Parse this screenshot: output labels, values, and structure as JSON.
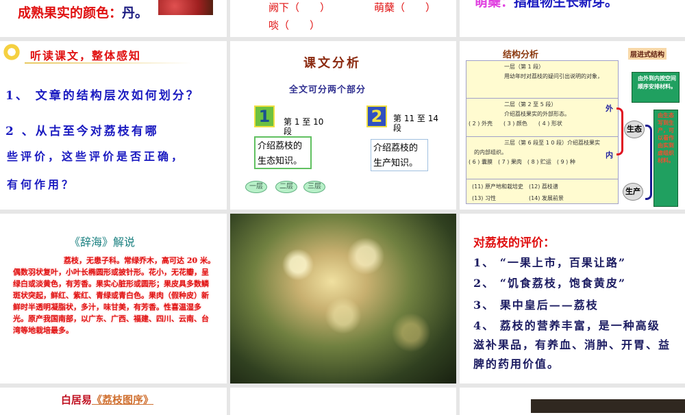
{
  "slides": [
    {
      "fruit_color_label": "成熟果实的颜色：",
      "fruit_color_value": "丹。"
    },
    {
      "item1": "阙下（　　）",
      "item2": "萌蘖（　　）",
      "item3": "啖（　　）"
    },
    {
      "term": "萌蘖：",
      "definition": "指植物生长新芽。"
    },
    {
      "title": "听读课文，整体感知",
      "q1": "1、 文章的结构层次如何划分？",
      "q2a": "2 、从古至今对荔枝有哪",
      "q2b": "些评价，这些评价是否正确，",
      "q2c": "有何作用？"
    },
    {
      "title": "课文分析",
      "subtitle": "全文可分两个部分",
      "part1_num": "1",
      "part1_range": "第 1 至 10 段",
      "part1_desc": "介绍荔枝的生态知识。",
      "part2_num": "2",
      "part2_range": "第 11 至 14 段",
      "part2_desc": "介绍荔枝的生产知识。",
      "layers": [
        "一层",
        "二层",
        "三层"
      ]
    },
    {
      "title": "结构分析",
      "tag": "层进式结构",
      "l1_head": "一层（第 1 段）",
      "l1_body": "用幼年时对荔枝的疑问引出说明的对象，",
      "l2_head": "二层（第 2 至 5 段）",
      "l2_body": "介绍荔枝果实的外部形态。",
      "l2_items": "( 2 ) 外壳　　( 3 ) 颜色　　( 4 ) 形状",
      "l3_head": "三层（第 6 段至 1 0 段）介绍荔枝果实",
      "l3_body": "的内部组织。",
      "l3_items": "( 6 ) 囊膜　( 7 ) 果肉　( 8 ) 贮运　( 9 ) 种",
      "p2_a": "(11) 原产地和栽培史",
      "p2_b": "(12) 荔枝谱",
      "p2_c": "(13) 习性",
      "p2_d": "(14) 发展前景",
      "outer": "外",
      "inner": "内",
      "eco": "生态",
      "prod": "生产",
      "callout1": "由外到内按空间顺序安排材料。",
      "callout2": "由生态写到生产，可以看作由实到虚组织材料。"
    },
    {
      "title": "《辞海》解说",
      "body": "荔枝，无患子科。常绿乔木，高可达 20 米。偶数羽状复叶，小叶长椭圆形或披针形。花小，无花瓣，呈绿白或淡黄色，有芳香。果实心脏形或圆形；果皮具多数鳞斑状突起，鲜红、紫红、青绿或青白色。果肉（假种皮）新鲜时半透明凝脂状，多汁，味甘美，有芳香。性喜温湿多光。原产我国南部，以广东、广西、福建、四川、云南、台湾等地栽培最多。"
    },
    {},
    {
      "title": "对荔枝的评价：",
      "items": [
        "1、 “一果上市，百果让路”",
        "2、 “饥食荔枝，饱食黄皮”",
        "3、 果中皇后——荔枝",
        "4、 荔枝的营养丰富，是一种高级滋补果品，有养血、消肿、开胃、益脾的药用价值。"
      ]
    },
    {
      "author": "白居易",
      "work": "《荔枝图序》"
    },
    {},
    {}
  ],
  "colors": {
    "red": "#e01010",
    "blue": "#1a1aa0",
    "teal": "#1a8080"
  }
}
